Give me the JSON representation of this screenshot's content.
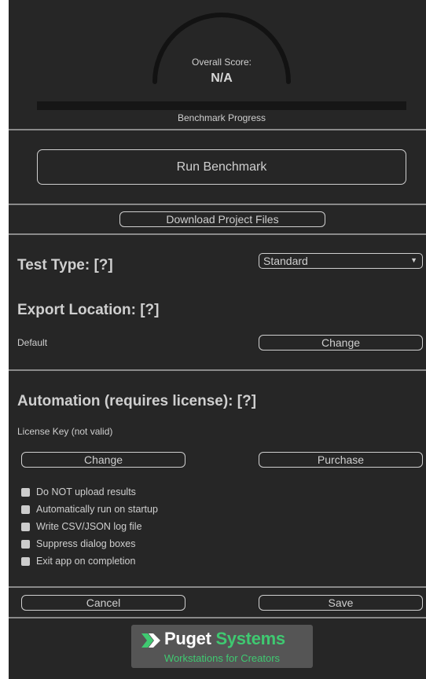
{
  "score": {
    "label": "Overall Score:",
    "value": "N/A"
  },
  "progress": {
    "label": "Benchmark Progress",
    "fraction": 0
  },
  "run_button": "Run Benchmark",
  "download_button": "Download Project Files",
  "test_type": {
    "heading": "Test Type:  [?]",
    "selected": "Standard"
  },
  "export_location": {
    "heading": "Export Location:  [?]",
    "value": "Default",
    "change_label": "Change"
  },
  "automation": {
    "heading": "Automation (requires license):  [?]",
    "license_label": "License Key (not valid)",
    "change_label": "Change",
    "purchase_label": "Purchase",
    "options": [
      "Do NOT upload results",
      "Automatically run on startup",
      "Write CSV/JSON log file",
      "Suppress dialog boxes",
      "Exit app on completion"
    ]
  },
  "footer": {
    "cancel_label": "Cancel",
    "save_label": "Save"
  },
  "logo": {
    "brand_first": "Puget",
    "brand_second": "Systems",
    "tagline": "Workstations for Creators"
  },
  "colors": {
    "panel_bg": "#262626",
    "brand_green": "#3fc971"
  }
}
